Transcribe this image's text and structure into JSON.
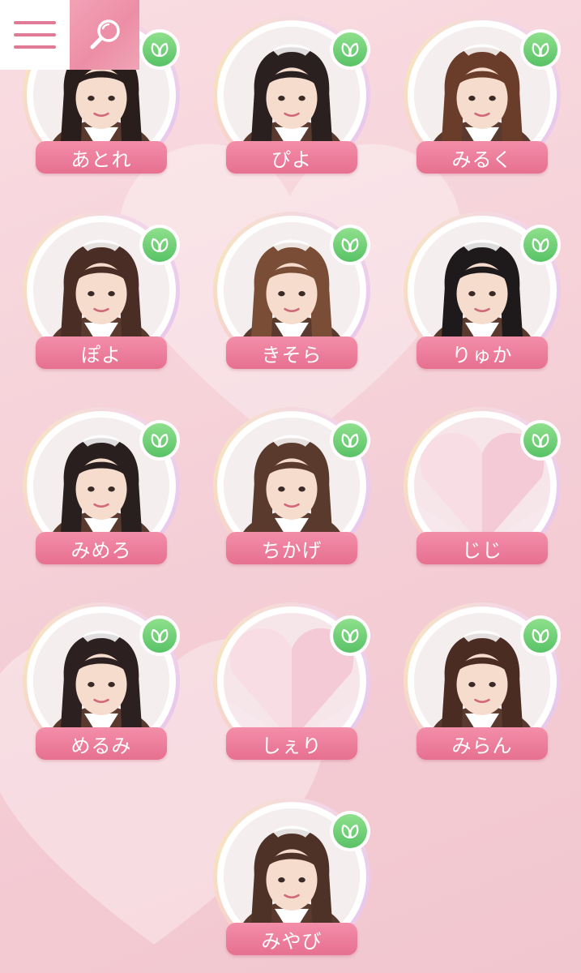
{
  "header": {
    "menu_icon": "hamburger-menu-icon",
    "search_icon": "magnifier-icon"
  },
  "colors": {
    "accent_pink": "#e6708f",
    "badge_green": "#58c266",
    "background": "#f6d3da"
  },
  "members": [
    {
      "name": "あとれ",
      "photo": "portrait",
      "hair": "#2a1e1c",
      "badge_icon": "leaf-icon"
    },
    {
      "name": "ぴよ",
      "photo": "portrait",
      "hair": "#2b2020",
      "badge_icon": "leaf-icon"
    },
    {
      "name": "みるく",
      "photo": "portrait",
      "hair": "#6a3c2a",
      "badge_icon": "leaf-icon"
    },
    {
      "name": "ぽよ",
      "photo": "portrait",
      "hair": "#4a2e26",
      "badge_icon": "leaf-icon"
    },
    {
      "name": "きそら",
      "photo": "portrait",
      "hair": "#7a4e36",
      "badge_icon": "leaf-icon"
    },
    {
      "name": "りゅか",
      "photo": "portrait",
      "hair": "#1e1a1c",
      "badge_icon": "leaf-icon"
    },
    {
      "name": "みめろ",
      "photo": "portrait",
      "hair": "#2a1f1f",
      "badge_icon": "leaf-icon"
    },
    {
      "name": "ちかげ",
      "photo": "portrait",
      "hair": "#5a3a2c",
      "badge_icon": "leaf-icon"
    },
    {
      "name": "じじ",
      "photo": "placeholder-heart",
      "hair": "",
      "badge_icon": "leaf-icon"
    },
    {
      "name": "めるみ",
      "photo": "portrait",
      "hair": "#2c2020",
      "badge_icon": "leaf-icon"
    },
    {
      "name": "しぇり",
      "photo": "placeholder-heart",
      "hair": "",
      "badge_icon": "leaf-icon"
    },
    {
      "name": "みらん",
      "photo": "portrait",
      "hair": "#4a2c22",
      "badge_icon": "leaf-icon"
    },
    {
      "name": "みやび",
      "photo": "portrait",
      "hair": "#4e3228",
      "badge_icon": "leaf-icon"
    }
  ]
}
